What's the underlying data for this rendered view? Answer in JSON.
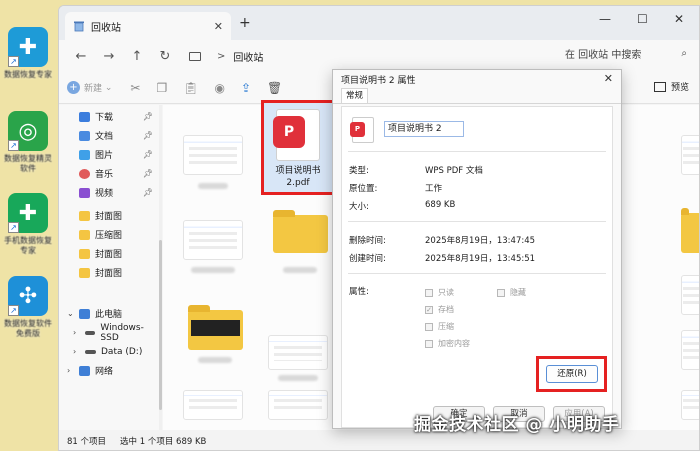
{
  "desktop": {
    "icons": [
      {
        "label": "数据恢复专家",
        "color": "#1e9bd7"
      },
      {
        "label": "数据恢复精灵软件",
        "color": "#2aa44a"
      },
      {
        "label": "手机数据恢复专家",
        "color": "#18a85a"
      },
      {
        "label": "数据恢复软件免费版",
        "color": "#1e90d8"
      }
    ]
  },
  "explorer": {
    "tab_title": "回收站",
    "tab_close": "✕",
    "tab_add": "+",
    "window_controls": {
      "minimize": "—",
      "maximize": "☐",
      "close": "✕"
    },
    "breadcrumb": {
      "separator": ">",
      "current": "回收站"
    },
    "search_placeholder": "在 回收站 中搜索",
    "toolbar": {
      "new_label": "新建",
      "preview_label": "预览"
    },
    "sidebar": {
      "quick": [
        {
          "label": "下载",
          "color": "#3b7ddd"
        },
        {
          "label": "文档",
          "color": "#4a8be0"
        },
        {
          "label": "图片",
          "color": "#3fa0e8"
        },
        {
          "label": "音乐",
          "color": "#e05a5a"
        },
        {
          "label": "视频",
          "color": "#8a4fd1"
        }
      ],
      "folders": [
        "封面图",
        "压缩图",
        "封面图",
        "封面图"
      ],
      "this_pc": "此电脑",
      "drives": [
        "Windows-SSD",
        "Data (D:)"
      ],
      "network": "网络"
    },
    "selected_file": {
      "name_line1": "项目说明书",
      "name_line2": "2.pdf"
    },
    "status": {
      "count": "81 个项目",
      "selected": "选中 1 个项目  689 KB"
    }
  },
  "dialog": {
    "title": "项目说明书 2 属性",
    "close": "✕",
    "tab": "常规",
    "file_name": "项目说明书 2",
    "rows": [
      {
        "label": "类型:",
        "value": "WPS PDF 文档"
      },
      {
        "label": "原位置:",
        "value": "工作"
      },
      {
        "label": "大小:",
        "value": "689 KB"
      },
      {
        "label": "删除时间:",
        "value": "2025年8月19日，13:47:45"
      },
      {
        "label": "创建时间:",
        "value": "2025年8月19日，13:45:51"
      }
    ],
    "attributes_label": "属性:",
    "checkboxes": [
      "只读",
      "隐藏",
      "存档",
      "压缩",
      "加密内容"
    ],
    "restore_button": "还原(R)",
    "ok_button": "确定",
    "cancel_button": "取消",
    "apply_button": "应用(A)"
  },
  "watermark": "掘金技术社区 @ 小明助手"
}
